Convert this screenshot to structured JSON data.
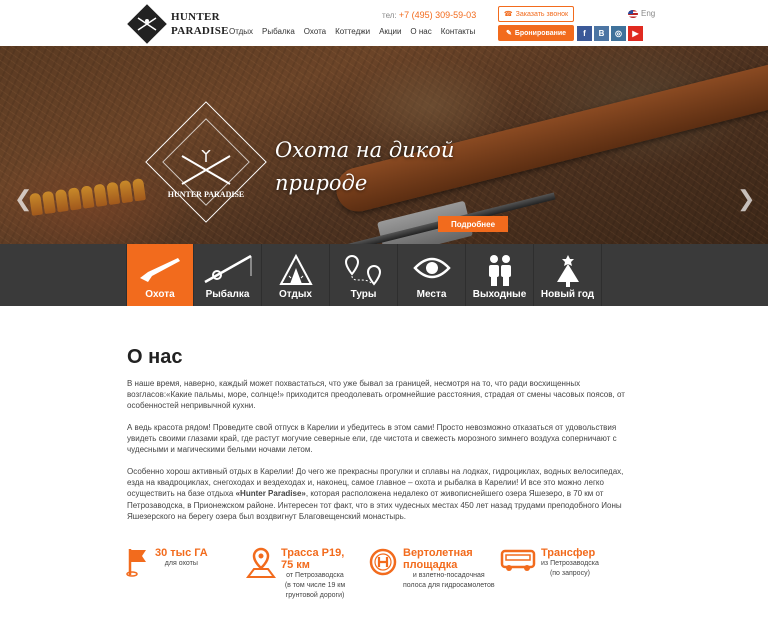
{
  "header": {
    "logo_line1": "HUNTER",
    "logo_line2": "PARADISE",
    "nav": [
      "Отдых",
      "Рыбалка",
      "Охота",
      "Коттеджи",
      "Акции",
      "О нас",
      "Контакты"
    ],
    "phone_prefix": "тел:",
    "phone": "+7 (495) 309-59-03",
    "call_button": "Заказать звонок",
    "book_button": "Бронирование",
    "lang": "Eng",
    "social": [
      "f",
      "B",
      "ig",
      "yt"
    ]
  },
  "hero": {
    "title_line1": "Охота на дикой",
    "title_line2": "природе",
    "button": "Подробнее",
    "badge_title": "HUNTER PARADISE"
  },
  "categories": [
    {
      "label": "Охота",
      "icon": "rifle-icon",
      "active": true
    },
    {
      "label": "Рыбалка",
      "icon": "fishing-rod-icon",
      "active": false
    },
    {
      "label": "Отдых",
      "icon": "tent-icon",
      "active": false
    },
    {
      "label": "Туры",
      "icon": "route-pins-icon",
      "active": false
    },
    {
      "label": "Места",
      "icon": "eye-icon",
      "active": false
    },
    {
      "label": "Выходные",
      "icon": "people-icon",
      "active": false
    },
    {
      "label": "Новый год",
      "icon": "christmas-tree-icon",
      "active": false
    }
  ],
  "about": {
    "title": "О нас",
    "p1": "В наше время, наверно, каждый может похвастаться, что уже бывал за границей, несмотря на то, что ради восхищенных возгласов:«Какие пальмы, море, солнце!» приходится преодолевать огромнейшие расстояния, страдая от смены часовых поясов, от особенностей непривычной кухни.",
    "p2": "А ведь красота рядом! Проведите свой отпуск в Карелии и убедитесь в этом сами! Просто невозможно отказаться от удовольствия увидеть своими глазами край, где растут могучие северные ели, где чистота и свежесть морозного зимнего воздуха соперничают с чудесными и магическими белыми ночами летом.",
    "p3_a": "Особенно хорош активный отдых в Карелии! До чего же прекрасны прогулки и сплавы на лодках, гидроциклах, водных велосипедах, езда на квадроциклах, снегоходах и вездеходах и, наконец, самое главное – охота и рыбалка в Карелии! И все это можно легко осуществить на базе отдыха ",
    "p3_b": "«Hunter Paradise»",
    "p3_c": ", которая расположена недалеко от живописнейшего озера Яшезеро, в 70 км от Петрозаводска, в Прионежском районе. Интересен тот факт, что в этих чудесных местах 450 лет назад трудами преподобного Ионы Яшезерского на берегу озера был воздвигнут Благовещенский монастырь."
  },
  "features": [
    {
      "head": "30 тыс ГА",
      "sub": [
        "для охоты"
      ],
      "icon": "flag-icon"
    },
    {
      "head": "Трасса Р19, 75 км",
      "sub": [
        "от Петрозаводска",
        "(в том числе 19 км",
        "грунтовой дороги)"
      ],
      "icon": "map-pin-icon"
    },
    {
      "head": "Вертолетная площадка",
      "sub": [
        "и взлетно-посадочная",
        "полоса для гидросамолетов"
      ],
      "icon": "helipad-icon"
    },
    {
      "head": "Трансфер",
      "sub": [
        "из Петрозаводска",
        "(по запросу)"
      ],
      "icon": "bus-icon"
    }
  ],
  "colors": {
    "accent": "#f26b1d",
    "dark_bar": "#3a3a3a"
  }
}
